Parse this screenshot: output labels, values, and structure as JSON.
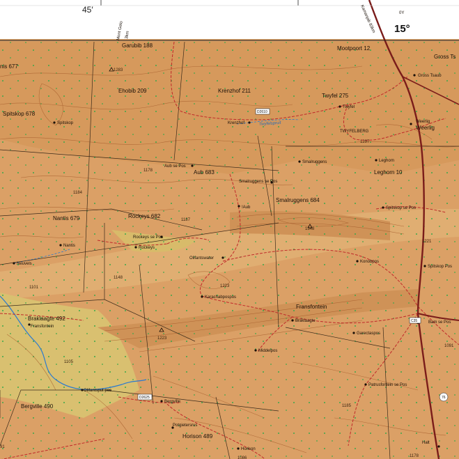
{
  "map": {
    "colors": {
      "terrain": "#dba066",
      "terrain_light": "#e3b57a",
      "terrain_dark": "#c98a4f",
      "yellow_plain": "#d9c070",
      "contour": "#a35a2a",
      "boundary": "#3a2a1a",
      "road_red": "#c0282a",
      "main_road": "#7a1c1a",
      "river": "#2a7ad0",
      "vegetation": "#3aa84a",
      "margin": "#ffffff"
    },
    "margin": {
      "longitude_left": "45′",
      "longitude_right": "15°",
      "grid_label": "0Y",
      "road_note_left": [
        "Mont Gelo",
        "3km"
      ],
      "road_note_right": "Kamanjab 83km"
    },
    "farms": [
      {
        "name": "Garubib 188"
      },
      {
        "name": "Mootpoort 12"
      },
      {
        "name": "Gross Ts"
      },
      {
        "name": "nis 677"
      },
      {
        "name": "Ehobib 209"
      },
      {
        "name": "Krenzhof 211"
      },
      {
        "name": "Twyfel 275"
      },
      {
        "name": "Spitskop 678"
      },
      {
        "name": "Weerlig"
      },
      {
        "name": "Aub 683"
      },
      {
        "name": "Leghorn 10"
      },
      {
        "name": "Smalruggens 684"
      },
      {
        "name": "Nantis 679"
      },
      {
        "name": "Rockeys 682"
      },
      {
        "name": "Fransfontein"
      },
      {
        "name": "Braklaagte 492"
      },
      {
        "name": "Bergville 490"
      },
      {
        "name": "Horison 489"
      }
    ],
    "places": [
      {
        "name": "Gross Tsaub"
      },
      {
        "name": "Twyfel"
      },
      {
        "name": "Krenzhof"
      },
      {
        "name": "Spitskop"
      },
      {
        "name": "Weerlig"
      },
      {
        "name": "Aub se Pos"
      },
      {
        "name": "Smalruggens"
      },
      {
        "name": "Smalruggens se Pos"
      },
      {
        "name": "!Aub"
      },
      {
        "name": "Leghorn"
      },
      {
        "name": "Spitskop se Pos"
      },
      {
        "name": "Rockeys se Pos"
      },
      {
        "name": "Rockeys"
      },
      {
        "name": "Nantis"
      },
      {
        "name": "Neuvels"
      },
      {
        "name": "Olifantswater"
      },
      {
        "name": "Konobpos"
      },
      {
        "name": "Spitskop Pos"
      },
      {
        "name": "Karachabpospos"
      },
      {
        "name": "Fransfontein"
      },
      {
        "name": "Braklaagte"
      },
      {
        "name": "Garectaspos"
      },
      {
        "name": "Middelpos"
      },
      {
        "name": "Patrusfontein se Pos"
      },
      {
        "name": "Olifantsput pos"
      },
      {
        "name": "Bergville"
      },
      {
        "name": "Potgietersrus"
      },
      {
        "name": "Horison"
      },
      {
        "name": "Halt"
      },
      {
        "name": "Bam se Pos"
      },
      {
        "name": "TWYFELBERG"
      }
    ],
    "spot_heights": [
      "1283",
      "1297",
      "1178",
      "1184",
      "1187",
      "1348",
      "1221",
      "1148",
      "1223",
      "1101",
      "1223",
      "1105",
      "1091",
      "1185",
      "1086",
      "1178",
      "91"
    ],
    "river_label": "Twyfelspruit",
    "road_numbers": [
      "D2625",
      "D2610",
      "76",
      "C35"
    ]
  }
}
